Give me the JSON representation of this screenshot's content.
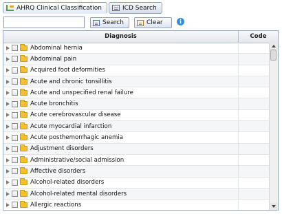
{
  "tabs": [
    {
      "label": "AHRQ Clinical Classification",
      "icon": "tree-icon",
      "active": true
    },
    {
      "label": "ICD Search",
      "icon": "form-icon",
      "active": false
    }
  ],
  "search": {
    "value": "",
    "placeholder": "",
    "search_label": "Search",
    "clear_label": "Clear"
  },
  "info_icon": "i",
  "grid": {
    "columns": {
      "diagnosis": "Diagnosis",
      "code": "Code"
    },
    "rows": [
      {
        "label": "Abdominal hernia"
      },
      {
        "label": "Abdominal pain"
      },
      {
        "label": "Acquired foot deformities"
      },
      {
        "label": "Acute and chronic tonsillitis"
      },
      {
        "label": "Acute and unspecified renal failure"
      },
      {
        "label": "Acute bronchitis"
      },
      {
        "label": "Acute cerebrovascular disease"
      },
      {
        "label": "Acute myocardial infarction"
      },
      {
        "label": "Acute posthemorrhagic anemia"
      },
      {
        "label": "Adjustment disorders"
      },
      {
        "label": "Administrative/social admission"
      },
      {
        "label": "Affective disorders"
      },
      {
        "label": "Alcohol-related disorders"
      },
      {
        "label": "Alcohol-related mental disorders"
      },
      {
        "label": "Allergic reactions"
      }
    ]
  },
  "colors": {
    "accent": "#2f8fdd",
    "folder": "#f3c033",
    "border": "#9aa8bd"
  }
}
